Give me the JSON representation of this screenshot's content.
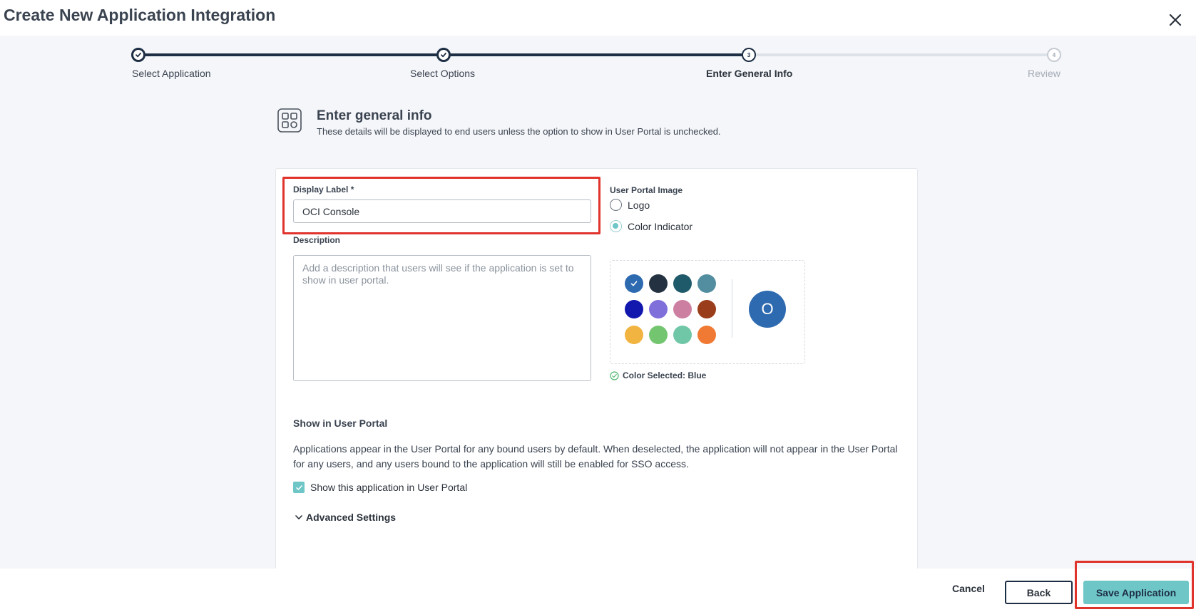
{
  "modal": {
    "title": "Create New Application Integration"
  },
  "stepper": {
    "steps": [
      {
        "label": "Select Application",
        "number": "1",
        "state": "done"
      },
      {
        "label": "Select Options",
        "number": "2",
        "state": "done"
      },
      {
        "label": "Enter General Info",
        "number": "3",
        "state": "current"
      },
      {
        "label": "Review",
        "number": "4",
        "state": "future"
      }
    ]
  },
  "section": {
    "title": "Enter general info",
    "description": "These details will be displayed to end users unless the option to show in User Portal is unchecked.",
    "icon": "apps-grid-icon"
  },
  "form": {
    "display_label": {
      "label": "Display Label *",
      "value": "OCI Console"
    },
    "description": {
      "label": "Description",
      "placeholder": "Add a description that users will see if the application is set to show in user portal.",
      "value": ""
    },
    "user_portal_image": {
      "label": "User Portal Image",
      "options": [
        {
          "label": "Logo",
          "checked": false
        },
        {
          "label": "Color Indicator",
          "checked": true
        }
      ]
    },
    "colors": [
      {
        "name": "Blue",
        "hex": "#2e6ab0",
        "selected": true
      },
      {
        "name": "Navy",
        "hex": "#243140",
        "selected": false
      },
      {
        "name": "Dark Teal",
        "hex": "#1f5a6b",
        "selected": false
      },
      {
        "name": "Slate Teal",
        "hex": "#528ea0",
        "selected": false
      },
      {
        "name": "Royal Blue",
        "hex": "#1217ae",
        "selected": false
      },
      {
        "name": "Purple",
        "hex": "#7f6fdb",
        "selected": false
      },
      {
        "name": "Pink",
        "hex": "#cd7fa2",
        "selected": false
      },
      {
        "name": "Rust",
        "hex": "#993d1a",
        "selected": false
      },
      {
        "name": "Yellow",
        "hex": "#f2b440",
        "selected": false
      },
      {
        "name": "Green",
        "hex": "#74c56f",
        "selected": false
      },
      {
        "name": "Mint",
        "hex": "#70c7a7",
        "selected": false
      },
      {
        "name": "Orange",
        "hex": "#f07a33",
        "selected": false
      }
    ],
    "preview_letter": "O",
    "color_selected_text": "Color Selected: Blue",
    "show_in_portal": {
      "title": "Show in User Portal",
      "description": "Applications appear in the User Portal for any bound users by default. When deselected, the application will not appear in the User Portal for any users, and any users bound to the application will still be enabled for SSO access.",
      "checkbox_label": "Show this application in User Portal",
      "checked": true
    },
    "advanced_settings": "Advanced Settings"
  },
  "footer": {
    "cancel": "Cancel",
    "back": "Back",
    "save": "Save Application"
  },
  "theme": {
    "accent": "#6ec6c6",
    "dark": "#1e2f45",
    "highlight": "#e0332b"
  }
}
